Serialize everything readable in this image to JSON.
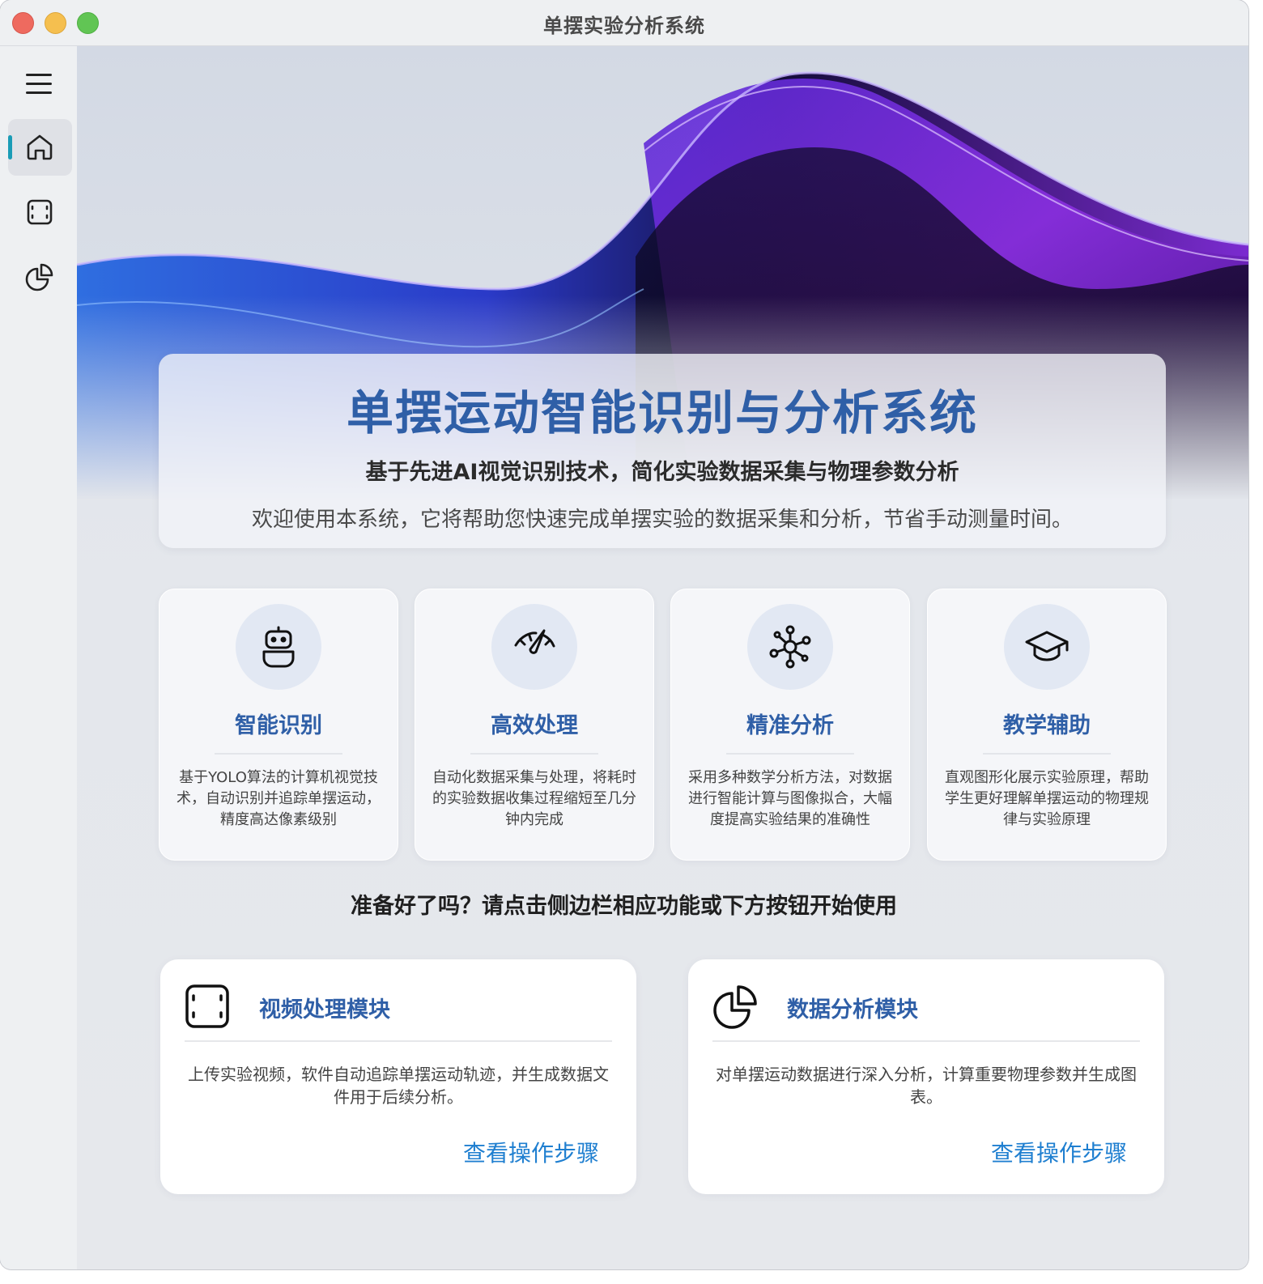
{
  "window": {
    "title": "单摆实验分析系统"
  },
  "sidebar": {
    "items": [
      {
        "name": "home",
        "icon": "home-icon",
        "active": true
      },
      {
        "name": "video",
        "icon": "film-icon",
        "active": false
      },
      {
        "name": "analysis",
        "icon": "pie-chart-icon",
        "active": false
      }
    ],
    "accent": "#1a9cb6"
  },
  "hero": {
    "title": "单摆运动智能识别与分析系统",
    "subtitle": "基于先进AI视觉识别技术，简化实验数据采集与物理参数分析",
    "description": "欢迎使用本系统，它将帮助您快速完成单摆实验的数据采集和分析，节省手动测量时间。"
  },
  "features": [
    {
      "icon": "robot-icon",
      "title": "智能识别",
      "desc": "基于YOLO算法的计算机视觉技术，自动识别并追踪单摆运动，精度高达像素级别"
    },
    {
      "icon": "speedometer-icon",
      "title": "高效处理",
      "desc": "自动化数据采集与处理，将耗时的实验数据收集过程缩短至几分钟内完成"
    },
    {
      "icon": "network-icon",
      "title": "精准分析",
      "desc": "采用多种数学分析方法，对数据进行智能计算与图像拟合，大幅度提高实验结果的准确性"
    },
    {
      "icon": "graduation-cap-icon",
      "title": "教学辅助",
      "desc": "直观图形化展示实验原理，帮助学生更好理解单摆运动的物理规律与实验原理"
    }
  ],
  "cta": "准备好了吗？请点击侧边栏相应功能或下方按钮开始使用",
  "modules": [
    {
      "icon": "film-icon",
      "title": "视频处理模块",
      "desc": "上传实验视频，软件自动追踪单摆运动轨迹，并生成数据文件用于后续分析。",
      "link": "查看操作步骤"
    },
    {
      "icon": "pie-chart-icon",
      "title": "数据分析模块",
      "desc": "对单摆运动数据进行深入分析，计算重要物理参数并生成图表。",
      "link": "查看操作步骤"
    }
  ],
  "colors": {
    "primary": "#2f5fa7",
    "link": "#1f7fd0"
  }
}
